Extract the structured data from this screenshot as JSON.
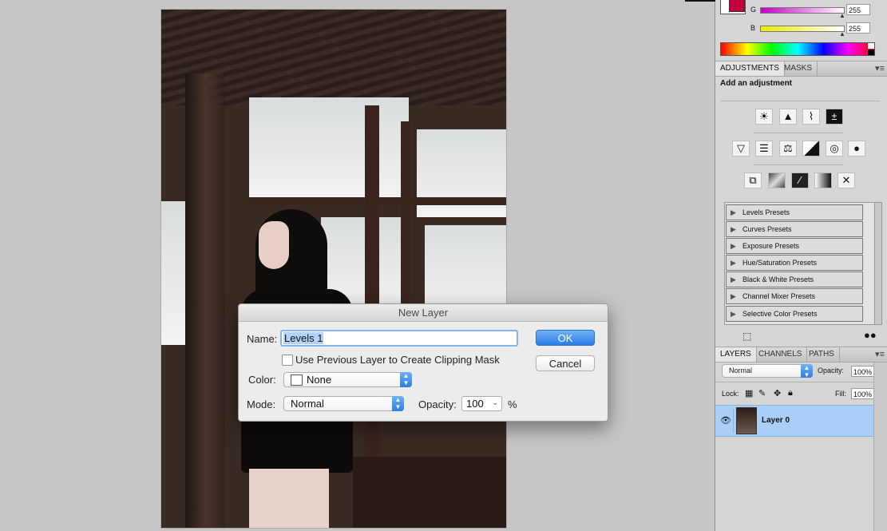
{
  "dialog": {
    "title": "New Layer",
    "name_label": "Name:",
    "name_value": "Levels 1",
    "clip_label": "Use Previous Layer to Create Clipping Mask",
    "color_label": "Color:",
    "color_value": "None",
    "mode_label": "Mode:",
    "mode_value": "Normal",
    "opacity_label": "Opacity:",
    "opacity_value": "100",
    "opacity_unit": "%",
    "ok_label": "OK",
    "cancel_label": "Cancel"
  },
  "color_panel": {
    "g_label": "G",
    "g_value": "255",
    "b_label": "B",
    "b_value": "255"
  },
  "adjustments_panel": {
    "tabs": [
      "ADJUSTMENTS",
      "MASKS"
    ],
    "heading": "Add an adjustment",
    "presets": [
      "Levels Presets",
      "Curves Presets",
      "Exposure Presets",
      "Hue/Saturation Presets",
      "Black & White Presets",
      "Channel Mixer Presets",
      "Selective Color Presets"
    ]
  },
  "layers_panel": {
    "tabs": [
      "LAYERS",
      "CHANNELS",
      "PATHS"
    ],
    "blend_mode": "Normal",
    "opacity_label": "Opacity:",
    "opacity_value": "100%",
    "lock_label": "Lock:",
    "fill_label": "Fill:",
    "fill_value": "100%",
    "layers": [
      {
        "name": "Layer 0"
      }
    ]
  },
  "colors": {
    "accent_blue": "#2b7de8",
    "selected_layer": "#a9cff6"
  }
}
